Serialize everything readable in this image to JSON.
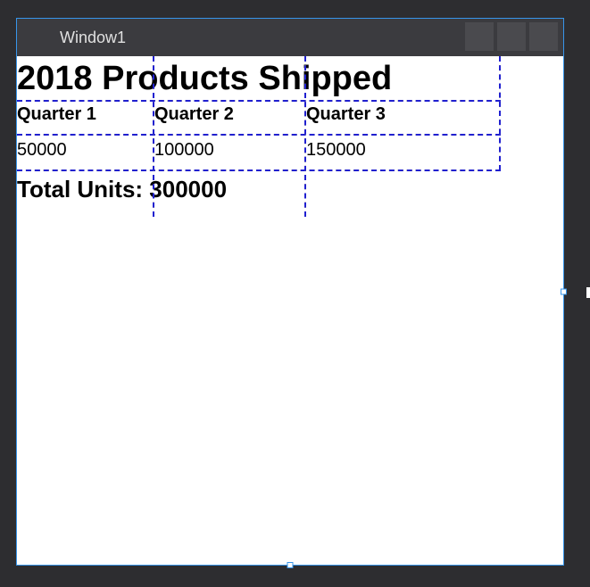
{
  "window": {
    "title": "Window1"
  },
  "content": {
    "title": "2018 Products Shipped",
    "headers": [
      "Quarter 1",
      "Quarter 2",
      "Quarter 3"
    ],
    "values": [
      "50000",
      "100000",
      "150000"
    ],
    "total_label": "Total Units: 300000"
  },
  "chart_data": {
    "type": "table",
    "title": "2018 Products Shipped",
    "categories": [
      "Quarter 1",
      "Quarter 2",
      "Quarter 3"
    ],
    "values": [
      50000,
      100000,
      150000
    ],
    "total": 300000,
    "total_label": "Total Units"
  }
}
